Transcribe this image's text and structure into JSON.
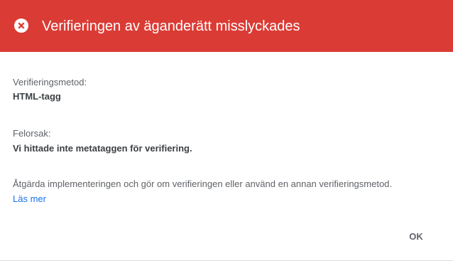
{
  "header": {
    "title": "Verifieringen av äganderätt misslyckades",
    "icon": "error-circle-icon",
    "background_color": "#db3b35"
  },
  "details": {
    "method_label": "Verifieringsmetod:",
    "method_value": "HTML-tagg",
    "reason_label": "Felorsak:",
    "reason_value": "Vi hittade inte metataggen för verifiering."
  },
  "instructions": {
    "text": "Åtgärda implementeringen och gör om verifieringen eller använd en annan verifieringsmetod.",
    "link_label": "Läs mer",
    "link_color": "#1a73e8"
  },
  "actions": {
    "ok_label": "OK"
  }
}
